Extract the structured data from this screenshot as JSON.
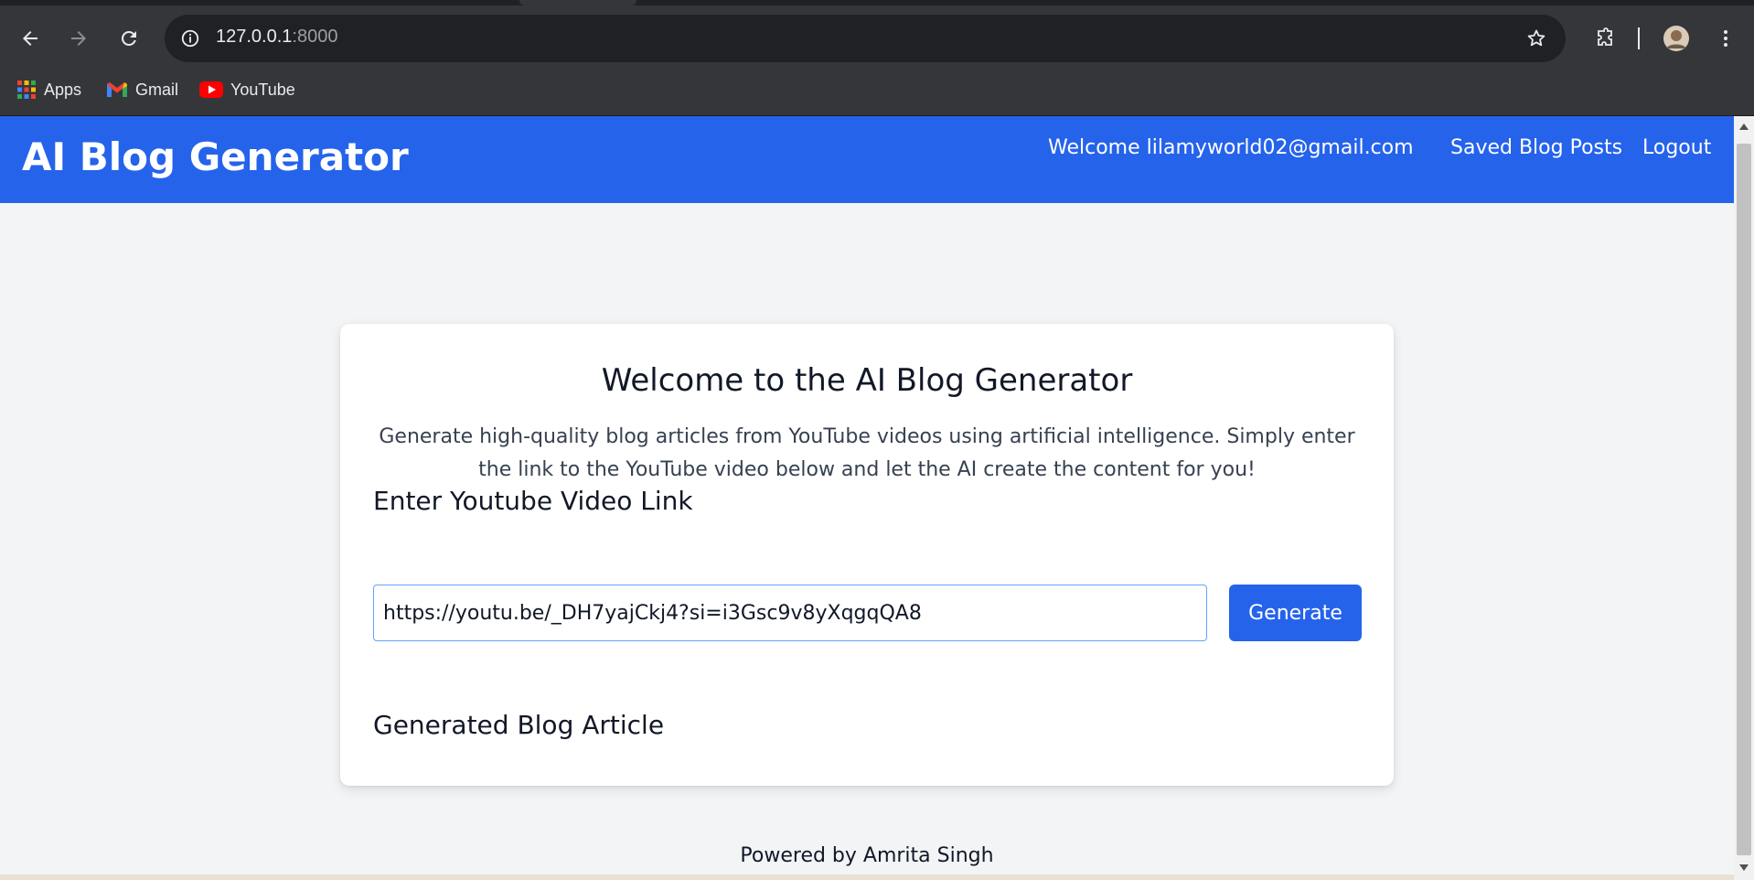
{
  "browser": {
    "url_host": "127.0.0.1",
    "url_port": ":8000",
    "bookmarks": [
      {
        "label": "Apps",
        "icon": "apps-grid-icon"
      },
      {
        "label": "Gmail",
        "icon": "gmail-icon"
      },
      {
        "label": "YouTube",
        "icon": "youtube-icon"
      }
    ]
  },
  "navbar": {
    "brand": "AI Blog Generator",
    "welcome": "Welcome lilamyworld02@gmail.com",
    "saved_link": "Saved Blog Posts",
    "logout_link": "Logout"
  },
  "main": {
    "title": "Welcome to the AI Blog Generator",
    "description": "Generate high-quality blog articles from YouTube videos using artificial intelligence. Simply enter the link to the YouTube video below and let the AI create the content for you!",
    "input_label": "Enter Youtube Video Link",
    "input_value": "https://youtu.be/_DH7yajCkj4?si=i3Gsc9v8yXqgqQA8",
    "generate_button": "Generate",
    "article_heading": "Generated Blog Article"
  },
  "footer": {
    "text": "Powered by Amrita Singh"
  },
  "colors": {
    "primary": "#2563eb",
    "page_bg": "#f3f4f6",
    "chrome_bg": "#35363a"
  }
}
